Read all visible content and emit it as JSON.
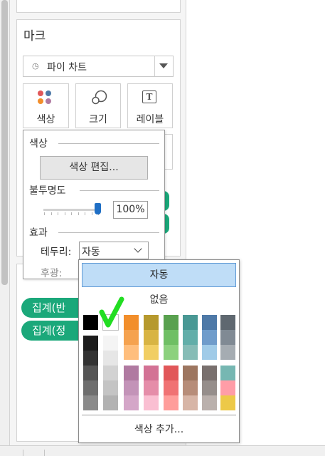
{
  "marks": {
    "title": "마크",
    "mark_type": "파이 차트",
    "buttons": {
      "color": "색상",
      "size": "크기",
      "label": "레이블"
    }
  },
  "pills": [
    "집계(반",
    "집계(정"
  ],
  "color_popup": {
    "color_section": "색상",
    "edit_colors": "색상 편집...",
    "opacity_section": "불투명도",
    "opacity_value": "100%",
    "opacity_percent": 100,
    "effects_section": "효과",
    "border_label": "테두리:",
    "border_value": "자동",
    "halo_label": "후광:"
  },
  "swatch_popup": {
    "auto": "자동",
    "none": "없음",
    "more_colors": "색상 추가...",
    "selected_swatch": "white"
  },
  "swatch_colors": {
    "neutral_top": [
      "#000000",
      "#ffffff"
    ],
    "neutral_cols": [
      [
        "#1c1c1c",
        "#333333",
        "#555555",
        "#6e6e6e",
        "#8a8a8a"
      ],
      [
        "#f4f4f4",
        "#e6e6e6",
        "#d2d2d2",
        "#c4c4c4",
        "#b2b2b2"
      ]
    ],
    "upper_cols": [
      [
        "#f28e2b",
        "#f5a24f",
        "#ffbe7d"
      ],
      [
        "#b6992d",
        "#d8b443",
        "#f1ce63"
      ],
      [
        "#59a14f",
        "#6fbf64",
        "#8cd17d"
      ],
      [
        "#499894",
        "#62aea9",
        "#86bcb6"
      ],
      [
        "#4e79a7",
        "#6f9ccb",
        "#a0cbe8"
      ],
      [
        "#5f6870",
        "#808a94",
        "#a5acb2"
      ]
    ],
    "lower_cols": [
      [
        "#b07aa1",
        "#c393b8",
        "#d4a6c8"
      ],
      [
        "#d37295",
        "#e58da9",
        "#fabfd2"
      ],
      [
        "#e15759",
        "#f07273",
        "#ff9d9a"
      ],
      [
        "#9d7660",
        "#b78d79",
        "#d7b5a6"
      ],
      [
        "#79706e",
        "#968e8b",
        "#bab0ac"
      ],
      [
        "#76b7b2",
        "#ff9da7",
        "#edc948"
      ]
    ]
  },
  "icons": {
    "color_dots": [
      "#e15759",
      "#4e79a7",
      "#f28e2b",
      "#b07aa1"
    ]
  }
}
